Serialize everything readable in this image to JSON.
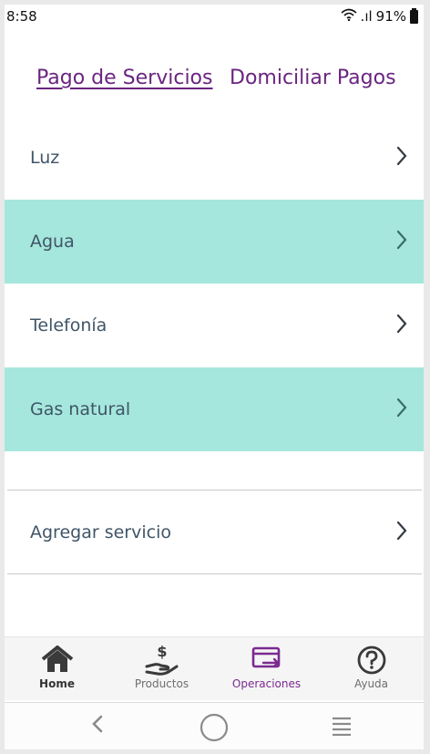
{
  "status_bar": {
    "time": "8:58",
    "signal": ".ıl",
    "battery": "91%"
  },
  "tabs": [
    {
      "label": "Pago de Servicios",
      "active": true
    },
    {
      "label": "Domiciliar Pagos",
      "active": false
    }
  ],
  "services": [
    {
      "label": "Luz",
      "highlight": false
    },
    {
      "label": "Agua",
      "highlight": true
    },
    {
      "label": "Telefonía",
      "highlight": false
    },
    {
      "label": "Gas natural",
      "highlight": true
    }
  ],
  "add_service": {
    "label": "Agregar servicio"
  },
  "bottom_nav": [
    {
      "label": "Home",
      "icon": "home-icon"
    },
    {
      "label": "Productos",
      "icon": "hand-dollar-icon"
    },
    {
      "label": "Operaciones",
      "icon": "card-transfer-icon",
      "active": true
    },
    {
      "label": "Ayuda",
      "icon": "help-icon"
    }
  ],
  "colors": {
    "accent": "#6a2580",
    "highlight": "#a5e7dc",
    "text": "#3f5568"
  }
}
